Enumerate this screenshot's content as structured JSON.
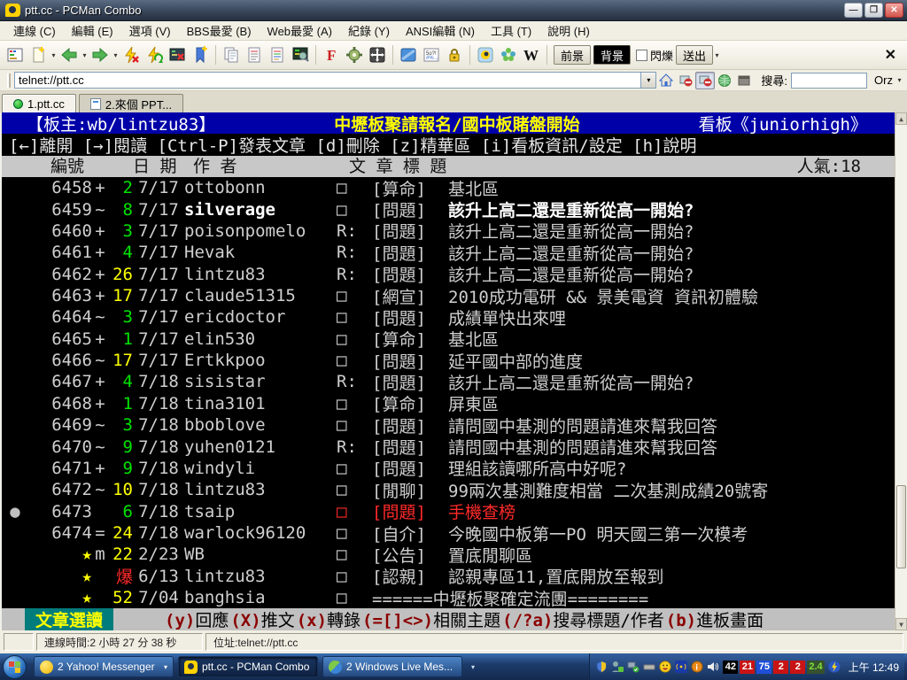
{
  "colors": {
    "ansi_green": "#00e400",
    "ansi_yellow": "#ffff00",
    "ansi_red": "#ff2a2a",
    "header_blue": "#0000a8",
    "mode_teal": "#007c7c",
    "key_darkred": "#8b0000"
  },
  "window": {
    "title": "ptt.cc - PCMan Combo",
    "minimize": "—",
    "restore": "❐",
    "close": "✕"
  },
  "menu": {
    "items": [
      "連線 (C)",
      "編輯 (E)",
      "選項 (V)",
      "BBS最愛 (B)",
      "Web最愛 (A)",
      "紀錄 (Y)",
      "ANSI編輯 (N)",
      "工具 (T)",
      "說明 (H)"
    ]
  },
  "toolbar": {
    "icons": [
      "ansi-editor",
      "new-connection",
      "back",
      "forward",
      "disconnect",
      "reconnect",
      "close-connection",
      "add-bookmark",
      "copy",
      "paste",
      "copy-ansi-color",
      "preview",
      "font",
      "settings",
      "fullscreen",
      "bbs-window",
      "special-symbols",
      "lock",
      "pcman-home",
      "plugin-flower",
      "wikipedia"
    ],
    "fg_label": "前景",
    "bg_label": "背景",
    "blink_label": "閃爍",
    "send_label": "送出",
    "close_label": "✕"
  },
  "addressbar": {
    "value": "telnet://ptt.cc",
    "search_label": "搜尋:",
    "search_value": "",
    "engine": "Orz"
  },
  "tabs": [
    {
      "label": "1.ptt.cc",
      "active": true
    },
    {
      "label": "2.來個 PPT...",
      "active": false
    }
  ],
  "bbs": {
    "board_header": {
      "left": "【板主:wb/lintzu83】",
      "middle": "中壢板聚請報名/國中板賭盤開始",
      "right": "看板《juniorhigh》"
    },
    "nav_line": "[←]離開 [→]閱讀 [Ctrl-P]發表文章 [d]刪除 [z]精華區 [i]看板資訊/設定 [h]說明",
    "columns": {
      "id": "編號",
      "date": "日 期",
      "author": "作 者",
      "title": "文 章 標 題",
      "popularity": "人氣:18"
    },
    "rows": [
      {
        "id": "6458",
        "mark": "+",
        "count": "2",
        "count_color": "green",
        "date": "7/17",
        "author": "ottobonn",
        "reply": "□",
        "category": "[算命]",
        "title": "基北區"
      },
      {
        "id": "6459",
        "mark": "~",
        "count": "8",
        "count_color": "green",
        "date": "7/17",
        "author": "silverage",
        "reply": "□",
        "category": "[問題]",
        "title": "該升上高二還是重新從高一開始?",
        "highlight": true
      },
      {
        "id": "6460",
        "mark": "+",
        "count": "3",
        "count_color": "green",
        "date": "7/17",
        "author": "poisonpomelo",
        "reply": "R:",
        "category": "[問題]",
        "title": "該升上高二還是重新從高一開始?"
      },
      {
        "id": "6461",
        "mark": "+",
        "count": "4",
        "count_color": "green",
        "date": "7/17",
        "author": "Hevak",
        "reply": "R:",
        "category": "[問題]",
        "title": "該升上高二還是重新從高一開始?"
      },
      {
        "id": "6462",
        "mark": "+",
        "count": "26",
        "count_color": "yellow",
        "date": "7/17",
        "author": "lintzu83",
        "reply": "R:",
        "category": "[問題]",
        "title": "該升上高二還是重新從高一開始?"
      },
      {
        "id": "6463",
        "mark": "+",
        "count": "17",
        "count_color": "yellow",
        "date": "7/17",
        "author": "claude51315",
        "reply": "□",
        "category": "[網宣]",
        "title": "2010成功電研 && 景美電資 資訊初體驗"
      },
      {
        "id": "6464",
        "mark": "~",
        "count": "3",
        "count_color": "green",
        "date": "7/17",
        "author": "ericdoctor",
        "reply": "□",
        "category": "[問題]",
        "title": "成績單快出來哩"
      },
      {
        "id": "6465",
        "mark": "+",
        "count": "1",
        "count_color": "green",
        "date": "7/17",
        "author": "elin530",
        "reply": "□",
        "category": "[算命]",
        "title": "基北區"
      },
      {
        "id": "6466",
        "mark": "~",
        "count": "17",
        "count_color": "yellow",
        "date": "7/17",
        "author": "Ertkkpoo",
        "reply": "□",
        "category": "[問題]",
        "title": "延平國中部的進度"
      },
      {
        "id": "6467",
        "mark": "+",
        "count": "4",
        "count_color": "green",
        "date": "7/18",
        "author": "sisistar",
        "reply": "R:",
        "category": "[問題]",
        "title": "該升上高二還是重新從高一開始?"
      },
      {
        "id": "6468",
        "mark": "+",
        "count": "1",
        "count_color": "green",
        "date": "7/18",
        "author": "tina3101",
        "reply": "□",
        "category": "[算命]",
        "title": "屏東區"
      },
      {
        "id": "6469",
        "mark": "~",
        "count": "3",
        "count_color": "green",
        "date": "7/18",
        "author": "bboblove",
        "reply": "□",
        "category": "[問題]",
        "title": "請問國中基測的問題請進來幫我回答"
      },
      {
        "id": "6470",
        "mark": "~",
        "count": "9",
        "count_color": "green",
        "date": "7/18",
        "author": "yuhen0121",
        "reply": "R:",
        "category": "[問題]",
        "title": "請問國中基測的問題請進來幫我回答"
      },
      {
        "id": "6471",
        "mark": "+",
        "count": "9",
        "count_color": "green",
        "date": "7/18",
        "author": "windyli",
        "reply": "□",
        "category": "[問題]",
        "title": "理組該讀哪所高中好呢?"
      },
      {
        "id": "6472",
        "mark": "~",
        "count": "10",
        "count_color": "yellow",
        "date": "7/18",
        "author": "lintzu83",
        "reply": "□",
        "category": "[閒聊]",
        "title": "99兩次基測難度相當 二次基測成績20號寄"
      },
      {
        "id": "6473",
        "mark": "",
        "count": "6",
        "count_color": "green",
        "date": "7/18",
        "author": "tsaip",
        "reply": "□",
        "category": "[問題]",
        "title": "手機查榜",
        "dot": true,
        "red": true
      },
      {
        "id": "6474",
        "mark": "=",
        "count": "24",
        "count_color": "yellow",
        "date": "7/18",
        "author": "warlock96120",
        "reply": "□",
        "category": "[自介]",
        "title": "今晚國中板第一PO 明天國三第一次模考"
      },
      {
        "star": true,
        "id": "",
        "mark": "m",
        "count": "22",
        "count_color": "yellow",
        "date": "2/23",
        "author": "WB",
        "reply": "□",
        "category": "[公告]",
        "title": "置底閒聊區"
      },
      {
        "star": true,
        "id": "",
        "mark": "",
        "count": "爆",
        "count_color": "red",
        "date": "6/13",
        "author": "lintzu83",
        "reply": "□",
        "category": "[認親]",
        "title": "認親專區11,置底開放至報到"
      },
      {
        "star": true,
        "id": "",
        "mark": "",
        "count": "52",
        "count_color": "yellow",
        "date": "7/04",
        "author": "banghsia",
        "reply": "□",
        "category": "",
        "title": "======中壢板聚確定流團========"
      }
    ],
    "footer": {
      "mode": "文章選讀",
      "hints": [
        {
          "key": "(y)",
          "label": "回應"
        },
        {
          "key": "(X)",
          "label": "推文"
        },
        {
          "key": "(x)",
          "label": "轉錄 "
        },
        {
          "key": "(=[]<>)",
          "label": "相關主題"
        },
        {
          "key": "(/?a)",
          "label": "搜尋標題/作者 "
        },
        {
          "key": "(b)",
          "label": "進板畫面"
        }
      ]
    }
  },
  "statusbar": {
    "connection_time": "連線時間:2 小時 27 分 38 秒",
    "address": "位址:telnet://ptt.cc"
  },
  "taskbar": {
    "items": [
      {
        "label": "2 Yahoo! Messenger",
        "icon": "yahoo",
        "dropdown": true
      },
      {
        "label": "ptt.cc - PCMan Combo",
        "icon": "pcman",
        "active": true
      },
      {
        "label": "2 Windows Live Mes...",
        "icon": "wlm"
      }
    ],
    "tray_icons": [
      "security-shield",
      "messenger-user",
      "network-ok",
      "removable-device",
      "yahoo-smiley",
      "wireless-signal",
      "info",
      "volume"
    ],
    "badges": [
      {
        "text": "42",
        "bg": "#000000",
        "fg": "#ffffff"
      },
      {
        "text": "21",
        "bg": "#c81414",
        "fg": "#ffffff"
      },
      {
        "text": "75",
        "bg": "#1f4fd8",
        "fg": "#ffffff"
      },
      {
        "text": "2",
        "bg": "#c81414",
        "fg": "#ffffff"
      },
      {
        "text": "2",
        "bg": "#c81414",
        "fg": "#ffffff"
      },
      {
        "text": "2.4",
        "bg": "#35512e",
        "fg": "#7ee03a"
      }
    ],
    "clock": "上午 12:49"
  }
}
